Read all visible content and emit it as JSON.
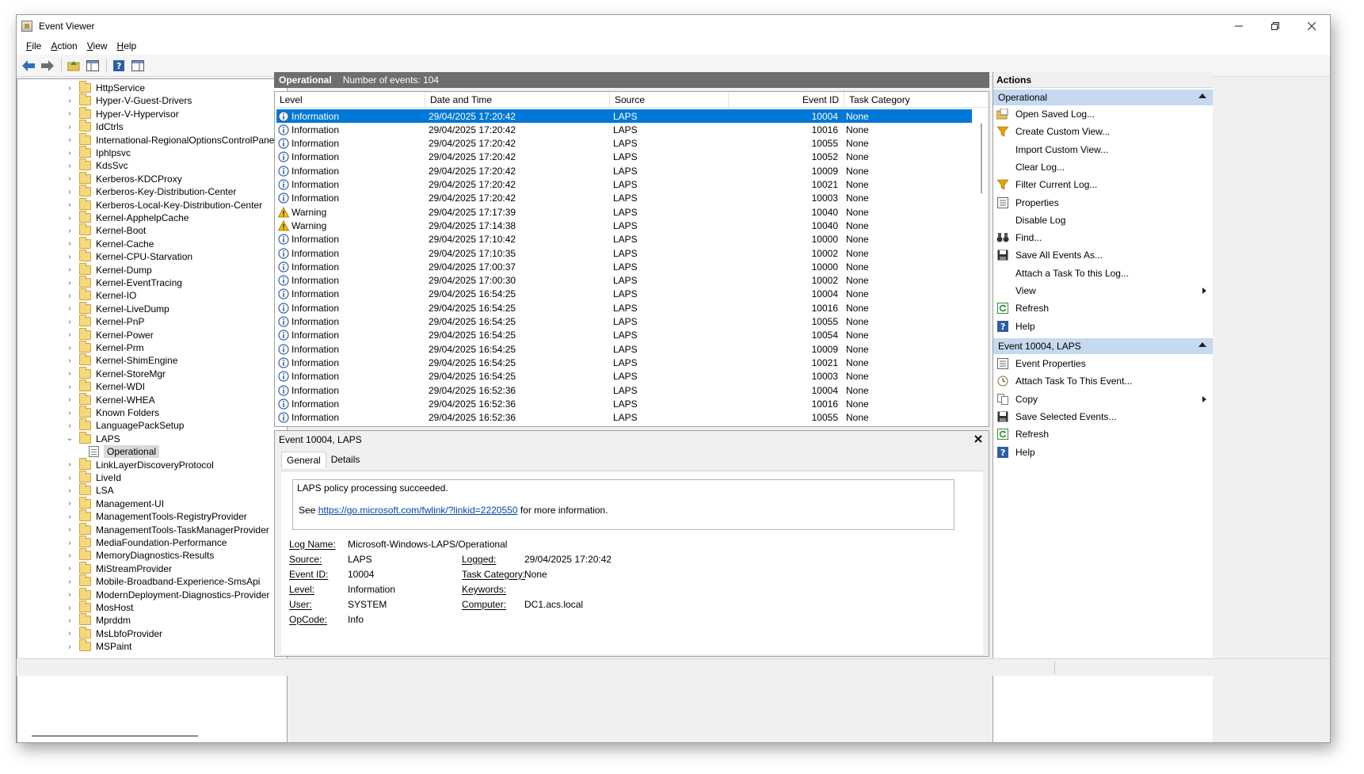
{
  "window": {
    "title": "Event Viewer",
    "controls": [
      "minimize",
      "restore",
      "close"
    ]
  },
  "menu": [
    "File",
    "Action",
    "View",
    "Help"
  ],
  "toolbar": [
    "back-arrow-icon",
    "forward-arrow-icon",
    "open-folder-icon",
    "console-tree-icon",
    "help-icon",
    "action-pane-icon"
  ],
  "tree": {
    "items": [
      {
        "label": "HttpService",
        "type": "folder"
      },
      {
        "label": "Hyper-V-Guest-Drivers",
        "type": "folder"
      },
      {
        "label": "Hyper-V-Hypervisor",
        "type": "folder"
      },
      {
        "label": "IdCtrls",
        "type": "folder"
      },
      {
        "label": "International-RegionalOptionsControlPanel",
        "type": "folder"
      },
      {
        "label": "Iphlpsvc",
        "type": "folder"
      },
      {
        "label": "KdsSvc",
        "type": "folder"
      },
      {
        "label": "Kerberos-KDCProxy",
        "type": "folder"
      },
      {
        "label": "Kerberos-Key-Distribution-Center",
        "type": "folder"
      },
      {
        "label": "Kerberos-Local-Key-Distribution-Center",
        "type": "folder"
      },
      {
        "label": "Kernel-ApphelpCache",
        "type": "folder"
      },
      {
        "label": "Kernel-Boot",
        "type": "folder"
      },
      {
        "label": "Kernel-Cache",
        "type": "folder"
      },
      {
        "label": "Kernel-CPU-Starvation",
        "type": "folder"
      },
      {
        "label": "Kernel-Dump",
        "type": "folder"
      },
      {
        "label": "Kernel-EventTracing",
        "type": "folder"
      },
      {
        "label": "Kernel-IO",
        "type": "folder"
      },
      {
        "label": "Kernel-LiveDump",
        "type": "folder"
      },
      {
        "label": "Kernel-PnP",
        "type": "folder"
      },
      {
        "label": "Kernel-Power",
        "type": "folder"
      },
      {
        "label": "Kernel-Prm",
        "type": "folder"
      },
      {
        "label": "Kernel-ShimEngine",
        "type": "folder"
      },
      {
        "label": "Kernel-StoreMgr",
        "type": "folder"
      },
      {
        "label": "Kernel-WDI",
        "type": "folder"
      },
      {
        "label": "Kernel-WHEA",
        "type": "folder"
      },
      {
        "label": "Known Folders",
        "type": "folder"
      },
      {
        "label": "LanguagePackSetup",
        "type": "folder"
      },
      {
        "label": "LAPS",
        "type": "folder",
        "expanded": true
      },
      {
        "label": "Operational",
        "type": "log",
        "selected": true
      },
      {
        "label": "LinkLayerDiscoveryProtocol",
        "type": "folder"
      },
      {
        "label": "LiveId",
        "type": "folder"
      },
      {
        "label": "LSA",
        "type": "folder"
      },
      {
        "label": "Management-UI",
        "type": "folder"
      },
      {
        "label": "ManagementTools-RegistryProvider",
        "type": "folder"
      },
      {
        "label": "ManagementTools-TaskManagerProvider",
        "type": "folder"
      },
      {
        "label": "MediaFoundation-Performance",
        "type": "folder"
      },
      {
        "label": "MemoryDiagnostics-Results",
        "type": "folder"
      },
      {
        "label": "MiStreamProvider",
        "type": "folder"
      },
      {
        "label": "Mobile-Broadband-Experience-SmsApi",
        "type": "folder"
      },
      {
        "label": "ModernDeployment-Diagnostics-Provider",
        "type": "folder"
      },
      {
        "label": "MosHost",
        "type": "folder"
      },
      {
        "label": "Mprddm",
        "type": "folder"
      },
      {
        "label": "MsLbfoProvider",
        "type": "folder"
      },
      {
        "label": "MSPaint",
        "type": "folder"
      }
    ]
  },
  "log_header": {
    "name": "Operational",
    "count_text": "Number of events: 104"
  },
  "grid": {
    "columns": [
      "Level",
      "Date and Time",
      "Source",
      "Event ID",
      "Task Category"
    ],
    "rows": [
      {
        "level": "Information",
        "date": "29/04/2025 17:20:42",
        "source": "LAPS",
        "id": "10004",
        "category": "None",
        "selected": true
      },
      {
        "level": "Information",
        "date": "29/04/2025 17:20:42",
        "source": "LAPS",
        "id": "10016",
        "category": "None"
      },
      {
        "level": "Information",
        "date": "29/04/2025 17:20:42",
        "source": "LAPS",
        "id": "10055",
        "category": "None"
      },
      {
        "level": "Information",
        "date": "29/04/2025 17:20:42",
        "source": "LAPS",
        "id": "10052",
        "category": "None"
      },
      {
        "level": "Information",
        "date": "29/04/2025 17:20:42",
        "source": "LAPS",
        "id": "10009",
        "category": "None"
      },
      {
        "level": "Information",
        "date": "29/04/2025 17:20:42",
        "source": "LAPS",
        "id": "10021",
        "category": "None"
      },
      {
        "level": "Information",
        "date": "29/04/2025 17:20:42",
        "source": "LAPS",
        "id": "10003",
        "category": "None"
      },
      {
        "level": "Warning",
        "date": "29/04/2025 17:17:39",
        "source": "LAPS",
        "id": "10040",
        "category": "None"
      },
      {
        "level": "Warning",
        "date": "29/04/2025 17:14:38",
        "source": "LAPS",
        "id": "10040",
        "category": "None"
      },
      {
        "level": "Information",
        "date": "29/04/2025 17:10:42",
        "source": "LAPS",
        "id": "10000",
        "category": "None"
      },
      {
        "level": "Information",
        "date": "29/04/2025 17:10:35",
        "source": "LAPS",
        "id": "10002",
        "category": "None"
      },
      {
        "level": "Information",
        "date": "29/04/2025 17:00:37",
        "source": "LAPS",
        "id": "10000",
        "category": "None"
      },
      {
        "level": "Information",
        "date": "29/04/2025 17:00:30",
        "source": "LAPS",
        "id": "10002",
        "category": "None"
      },
      {
        "level": "Information",
        "date": "29/04/2025 16:54:25",
        "source": "LAPS",
        "id": "10004",
        "category": "None"
      },
      {
        "level": "Information",
        "date": "29/04/2025 16:54:25",
        "source": "LAPS",
        "id": "10016",
        "category": "None"
      },
      {
        "level": "Information",
        "date": "29/04/2025 16:54:25",
        "source": "LAPS",
        "id": "10055",
        "category": "None"
      },
      {
        "level": "Information",
        "date": "29/04/2025 16:54:25",
        "source": "LAPS",
        "id": "10054",
        "category": "None"
      },
      {
        "level": "Information",
        "date": "29/04/2025 16:54:25",
        "source": "LAPS",
        "id": "10009",
        "category": "None"
      },
      {
        "level": "Information",
        "date": "29/04/2025 16:54:25",
        "source": "LAPS",
        "id": "10021",
        "category": "None"
      },
      {
        "level": "Information",
        "date": "29/04/2025 16:54:25",
        "source": "LAPS",
        "id": "10003",
        "category": "None"
      },
      {
        "level": "Information",
        "date": "29/04/2025 16:52:36",
        "source": "LAPS",
        "id": "10004",
        "category": "None"
      },
      {
        "level": "Information",
        "date": "29/04/2025 16:52:36",
        "source": "LAPS",
        "id": "10016",
        "category": "None"
      },
      {
        "level": "Information",
        "date": "29/04/2025 16:52:36",
        "source": "LAPS",
        "id": "10055",
        "category": "None"
      }
    ]
  },
  "detail": {
    "title": "Event 10004, LAPS",
    "tabs": [
      "General",
      "Details"
    ],
    "description": "LAPS policy processing succeeded.",
    "more_prefix": "See",
    "more_link": "https://go.microsoft.com/fwlink/?linkid=2220550",
    "more_suffix": "for more information.",
    "fields": {
      "log_name_label": "Log Name:",
      "log_name": "Microsoft-Windows-LAPS/Operational",
      "source_label": "Source:",
      "source": "LAPS",
      "logged_label": "Logged:",
      "logged": "29/04/2025 17:20:42",
      "event_id_label": "Event ID:",
      "event_id": "10004",
      "task_category_label": "Task Category:",
      "task_category": "None",
      "level_label": "Level:",
      "level": "Information",
      "keywords_label": "Keywords:",
      "keywords": "",
      "user_label": "User:",
      "user": "SYSTEM",
      "computer_label": "Computer:",
      "computer": "DC1.acs.local",
      "opcode_label": "OpCode:",
      "opcode": "Info"
    }
  },
  "actions": {
    "title": "Actions",
    "section1": "Operational",
    "items1": [
      {
        "label": "Open Saved Log...",
        "icon": "open-log-icon"
      },
      {
        "label": "Create Custom View...",
        "icon": "filter-icon"
      },
      {
        "label": "Import Custom View...",
        "icon": ""
      },
      {
        "label": "Clear Log...",
        "icon": ""
      },
      {
        "label": "Filter Current Log...",
        "icon": "filter-icon"
      },
      {
        "label": "Properties",
        "icon": "properties-icon"
      },
      {
        "label": "Disable Log",
        "icon": ""
      },
      {
        "label": "Find...",
        "icon": "binoculars-icon"
      },
      {
        "label": "Save All Events As...",
        "icon": "save-icon"
      },
      {
        "label": "Attach a Task To this Log...",
        "icon": ""
      },
      {
        "label": "View",
        "icon": "",
        "submenu": true
      },
      {
        "label": "Refresh",
        "icon": "refresh-icon"
      },
      {
        "label": "Help",
        "icon": "help-icon"
      }
    ],
    "section2": "Event 10004, LAPS",
    "items2": [
      {
        "label": "Event Properties",
        "icon": "properties-icon"
      },
      {
        "label": "Attach Task To This Event...",
        "icon": "task-icon"
      },
      {
        "label": "Copy",
        "icon": "copy-icon",
        "submenu": true
      },
      {
        "label": "Save Selected Events...",
        "icon": "save-icon"
      },
      {
        "label": "Refresh",
        "icon": "refresh-icon"
      },
      {
        "label": "Help",
        "icon": "help-icon"
      }
    ]
  },
  "colors": {
    "selection": "#0078d7",
    "section_header": "#c5d9ef",
    "link": "#0645ad",
    "header_bar": "#6e6e6e"
  }
}
